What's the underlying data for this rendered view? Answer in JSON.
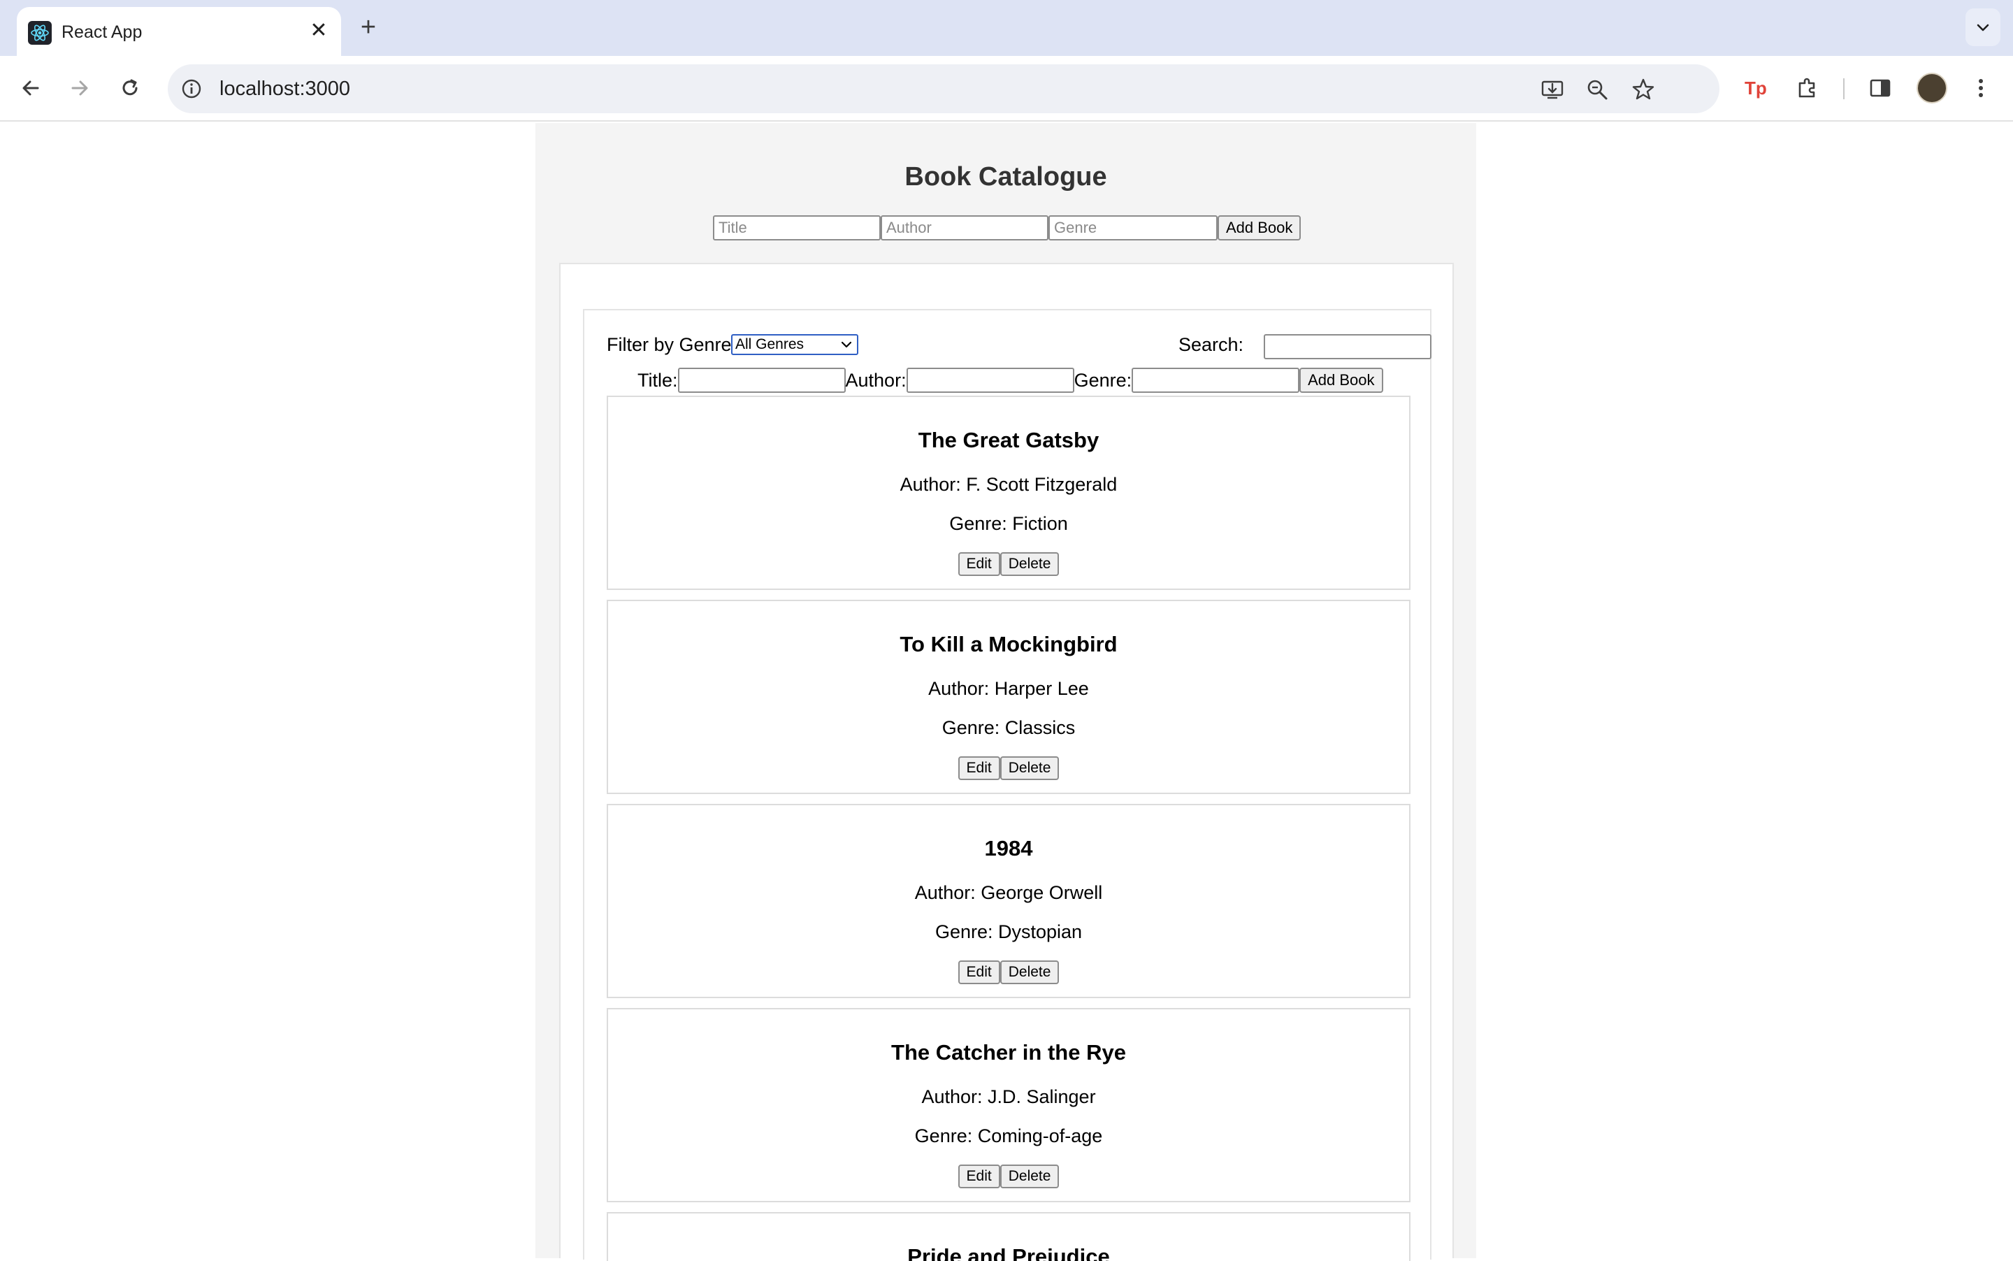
{
  "browser": {
    "tab_title": "React App",
    "url": "localhost:3000"
  },
  "app": {
    "title": "Book Catalogue",
    "top_form": {
      "title_placeholder": "Title",
      "author_placeholder": "Author",
      "genre_placeholder": "Genre",
      "add_label": "Add Book"
    },
    "filter": {
      "label": "Filter by Genre:",
      "selected": "All Genres"
    },
    "search": {
      "label": "Search:"
    },
    "add_form": {
      "title_label": "Title:",
      "author_label": "Author:",
      "genre_label": "Genre:",
      "add_label": "Add Book"
    },
    "books": [
      {
        "title": "The Great Gatsby",
        "author": "Author: F. Scott Fitzgerald",
        "genre": "Genre: Fiction",
        "edit": "Edit",
        "delete": "Delete"
      },
      {
        "title": "To Kill a Mockingbird",
        "author": "Author: Harper Lee",
        "genre": "Genre: Classics",
        "edit": "Edit",
        "delete": "Delete"
      },
      {
        "title": "1984",
        "author": "Author: George Orwell",
        "genre": "Genre: Dystopian",
        "edit": "Edit",
        "delete": "Delete"
      },
      {
        "title": "The Catcher in the Rye",
        "author": "Author: J.D. Salinger",
        "genre": "Genre: Coming-of-age",
        "edit": "Edit",
        "delete": "Delete"
      },
      {
        "title": "Pride and Prejudice"
      }
    ]
  },
  "colors": {
    "tabbar": "#dde3f4",
    "app_background": "#f4f4f4",
    "select_focus": "#2f5fc4"
  }
}
